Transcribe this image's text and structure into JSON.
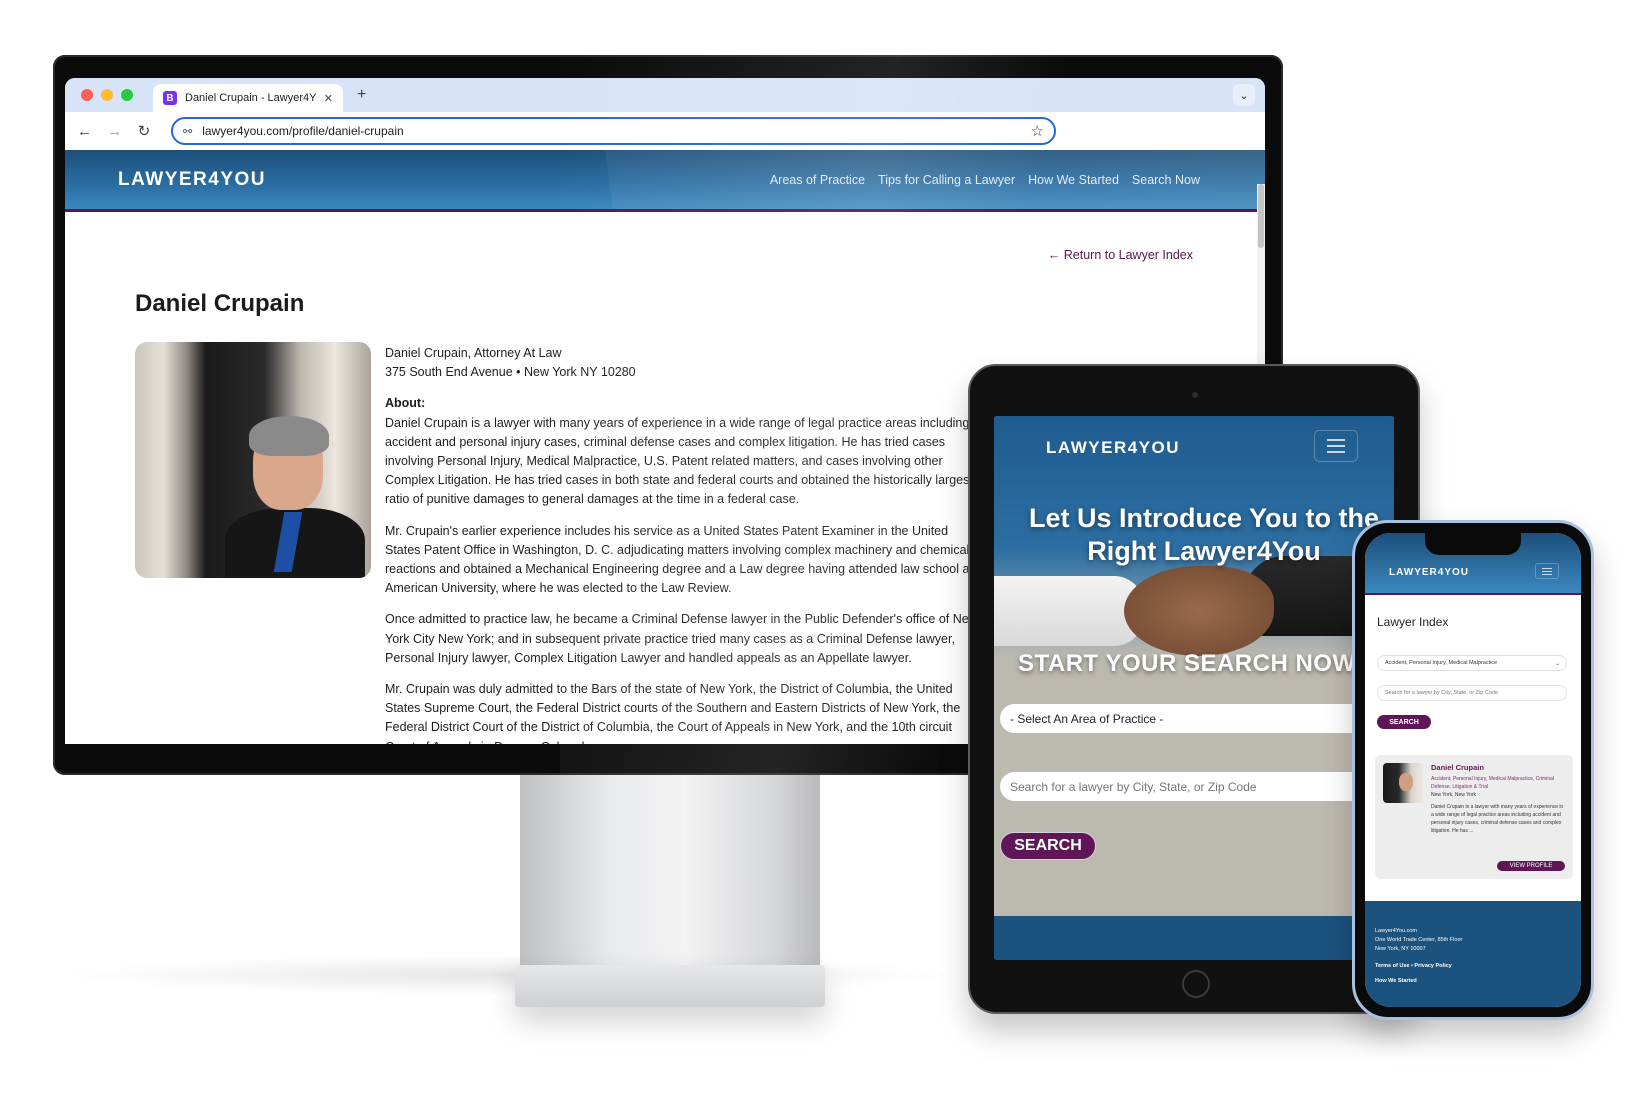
{
  "browser": {
    "tab_title": "Daniel Crupain - Lawyer4You",
    "favicon_letter": "B",
    "new_tab": "+",
    "tab_close": "✕",
    "tab_menu": "⌄",
    "back": "←",
    "forward": "→",
    "reload": "↻",
    "site_info": "⚯",
    "url": "lawyer4you.com/profile/daniel-crupain",
    "bookmark": "☆"
  },
  "site": {
    "logo": "LAWYER4YOU",
    "nav": [
      "Areas of Practice",
      "Tips for Calling a Lawyer",
      "How We Started",
      "Search Now"
    ],
    "brand_colors": {
      "header_blue": "#2a6ea3",
      "accent_purple": "#5e1656"
    }
  },
  "profile": {
    "return_link": "← Return to Lawyer Index",
    "name": "Daniel Crupain",
    "title_line": "Daniel Crupain, Attorney At Law",
    "address_line": "375 South End Avenue • New York NY 10280",
    "about_label": "About:",
    "paragraphs": [
      "Daniel  Crupain is a lawyer with many years of experience in a wide range of legal practice areas including accident and personal injury cases, criminal defense cases and complex litigation. He has tried cases involving Personal Injury, Medical Malpractice, U.S. Patent related matters, and cases involving other Complex Litigation. He has tried cases in both state and federal courts and obtained the historically largest ratio of punitive damages to general damages at the time in a federal case.",
      "Mr. Crupain's earlier experience includes his service as a United States Patent Examiner in the United States Patent Office in Washington, D. C. adjudicating matters involving complex machinery and chemical reactions and obtained a Mechanical Engineering degree and a Law degree having attended law school at American University, where he was elected to the Law Review.",
      "Once admitted to practice law, he became a Criminal Defense lawyer in the Public Defender's office of New York City New York; and in subsequent private practice tried many cases as a Criminal Defense lawyer, Personal Injury lawyer, Complex Litigation Lawyer and handled appeals as an Appellate lawyer.",
      "Mr. Crupain was duly admitted to the Bars of the state of New York, the District of Columbia, the United States Supreme Court, the Federal District courts of the Southern and Eastern Districts of New York, the Federal District Court of the District of Columbia, the Court of Appeals in New York, and the 10th circuit Court of Appeals in Denver, Colorado."
    ]
  },
  "tablet": {
    "logo": "LAWYER4YOU",
    "hero_title": "Let Us Introduce You to the Right Lawyer4You",
    "cta": "START YOUR SEARCH NOW!",
    "select_value": "- Select An Area of Practice -",
    "search_placeholder": "Search for a lawyer by City, State, or Zip Code",
    "search_button": "SEARCH"
  },
  "phone": {
    "logo": "LAWYER4YOU",
    "page_title": "Lawyer Index",
    "select_value": "Accident, Personal Injury, Medical Malpractice",
    "search_placeholder": "Search for a lawyer by City, State, or Zip Code",
    "search_button": "SEARCH",
    "card": {
      "name": "Daniel Crupain",
      "areas": "Accident, Personal Injury, Medical Malpractice, Criminal Defense, Litigation & Trial",
      "location": "New York, New York",
      "description": "Daniel Crupain is a lawyer with many years of experience in a wide range of legal practice areas including accident and personal injury cases, criminal defense cases and complex litigation. He has ...",
      "button": "VIEW PROFILE"
    },
    "footer": {
      "site": "Lawyer4You.com",
      "address1": "One World Trade Center, 85th Floor",
      "address2": "New York, NY 10007",
      "links": "Terms of Use • Privacy Policy",
      "how_started": "How We Started"
    }
  }
}
